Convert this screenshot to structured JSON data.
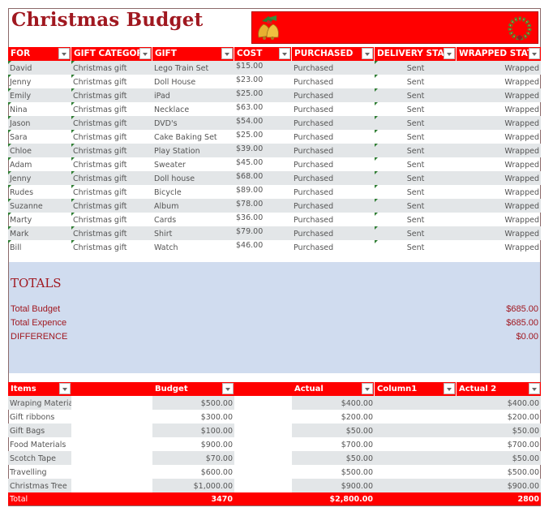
{
  "title": "Christmas Budget",
  "banner": {
    "left_icon": "bells-icon",
    "right_icon": "wreath-icon"
  },
  "gift_table": {
    "columns": [
      "FOR",
      "GIFT CATEGORY",
      "GIFT",
      "COST",
      "PURCHASED",
      "DELIVERY STATUS",
      "WRAPPED STATUS"
    ],
    "column_display": [
      "FOR",
      "GIFT CATEGOR",
      "GIFT",
      "COST",
      "PURCHASED",
      "DELIVERY STAT",
      "WRAPPED STAT"
    ],
    "rows": [
      [
        "David",
        "Christmas gift",
        "Lego Train Set",
        "$15.00",
        "Purchased",
        "Sent",
        "Wrapped"
      ],
      [
        "Jenny",
        "Christmas gift",
        "Doll House",
        "$23.00",
        "Purchased",
        "Sent",
        "Wrapped"
      ],
      [
        "Emily",
        "Christmas gift",
        "iPad",
        "$25.00",
        "Purchased",
        "Sent",
        "Wrapped"
      ],
      [
        "Nina",
        "Christmas gift",
        "Necklace",
        "$63.00",
        "Purchased",
        "Sent",
        "Wrapped"
      ],
      [
        "Jason",
        "Christmas gift",
        "DVD's",
        "$54.00",
        "Purchased",
        "Sent",
        "Wrapped"
      ],
      [
        "Sara",
        "Christmas gift",
        "Cake Baking Set",
        "$25.00",
        "Purchased",
        "Sent",
        "Wrapped"
      ],
      [
        "Chloe",
        "Christmas gift",
        "Play Station",
        "$39.00",
        "Purchased",
        "Sent",
        "Wrapped"
      ],
      [
        "Adam",
        "Christmas gift",
        "Sweater",
        "$45.00",
        "Purchased",
        "Sent",
        "Wrapped"
      ],
      [
        "Jenny",
        "Christmas gift",
        "Doll house",
        "$68.00",
        "Purchased",
        "Sent",
        "Wrapped"
      ],
      [
        "Rudes",
        "Christmas gift",
        "Bicycle",
        "$89.00",
        "Purchased",
        "Sent",
        "Wrapped"
      ],
      [
        "Suzanne",
        "Christmas gift",
        "Album",
        "$78.00",
        "Purchased",
        "Sent",
        "Wrapped"
      ],
      [
        "Marty",
        "Christmas gift",
        "Cards",
        "$36.00",
        "Purchased",
        "Sent",
        "Wrapped"
      ],
      [
        "Mark",
        "Christmas gift",
        "Shirt",
        "$79.00",
        "Purchased",
        "Sent",
        "Wrapped"
      ],
      [
        "Bill",
        "Christmas gift",
        "Watch",
        "$46.00",
        "Purchased",
        "Sent",
        "Wrapped"
      ]
    ]
  },
  "totals": {
    "heading": "TOTALS",
    "lines": [
      {
        "label": "Total Budget",
        "value": "$685.00"
      },
      {
        "label": "Total Expence",
        "value": "$685.00"
      },
      {
        "label": "DIFFERENCE",
        "value": "$0.00"
      }
    ]
  },
  "items_table": {
    "columns": [
      "Items",
      "",
      "Budget",
      "",
      "Actual",
      "Column1",
      "Actual 2"
    ],
    "rows": [
      [
        "Wraping Material",
        "$500.00",
        "$400.00",
        "$400.00"
      ],
      [
        "Gift ribbons",
        "$300.00",
        "$200.00",
        "$200.00"
      ],
      [
        "Gift Bags",
        "$100.00",
        "$50.00",
        "$50.00"
      ],
      [
        "Food Materials",
        "$900.00",
        "$700.00",
        "$700.00"
      ],
      [
        "Scotch Tape",
        "$70.00",
        "$50.00",
        "$50.00"
      ],
      [
        "Travelling",
        "$600.00",
        "$500.00",
        "$500.00"
      ],
      [
        "Christmas Tree",
        "$1,000.00",
        "$900.00",
        "$900.00"
      ]
    ],
    "total": {
      "label": "Total",
      "budget": "3470",
      "actual": "$2,800.00",
      "actual2": "2800"
    }
  },
  "colors": {
    "accent": "#ff0000",
    "title": "#a01820",
    "totals_bg": "#d0dcef",
    "row_shade": "#e3e6e8"
  }
}
